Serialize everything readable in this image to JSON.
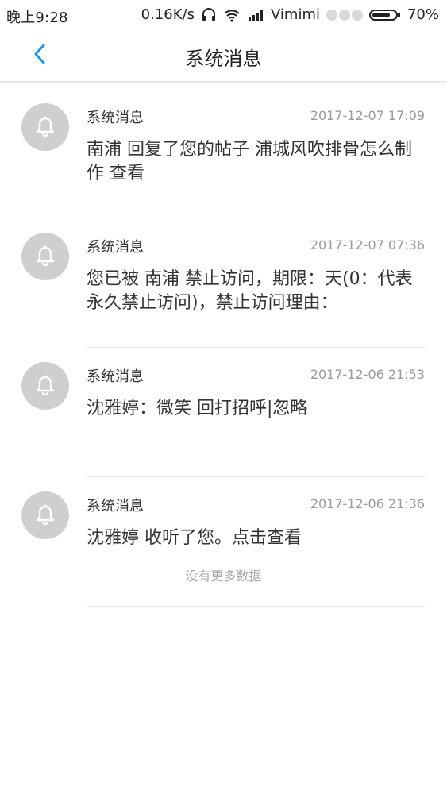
{
  "status_bar": {
    "time": "晚上9:28",
    "speed": "0.16K/s",
    "carrier": "Vimimi",
    "battery": "70%"
  },
  "header": {
    "title": "系统消息",
    "back_icon": "chevron-left-icon"
  },
  "messages": [
    {
      "sender": "系统消息",
      "time": "2017-12-07 17:09",
      "content": "南浦 回复了您的帖子 浦城风吹排骨怎么制作   查看"
    },
    {
      "sender": "系统消息",
      "time": "2017-12-07 07:36",
      "content": "您已被 南浦 禁止访问，期限：天(0：代表永久禁止访问)，禁止访问理由："
    },
    {
      "sender": "系统消息",
      "time": "2017-12-06 21:53",
      "content": "沈雅婷：微笑 回打招呼|忽略"
    },
    {
      "sender": "系统消息",
      "time": "2017-12-06 21:36",
      "content": "沈雅婷 收听了您。点击查看"
    }
  ],
  "footer": {
    "no_more_text": "没有更多数据"
  },
  "colors": {
    "accent": "#1a9be6",
    "avatar_bg": "#cfcfcf",
    "divider": "#e7e7e7"
  }
}
